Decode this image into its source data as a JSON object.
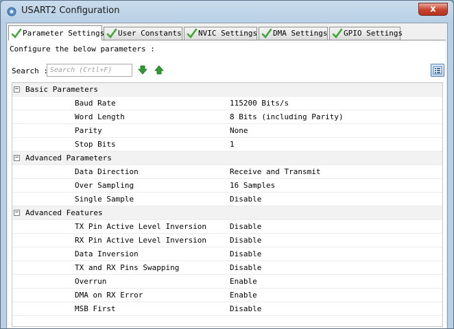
{
  "window": {
    "title": "USART2 Configuration",
    "close_label": "x"
  },
  "tabs": [
    {
      "label": "Parameter Settings",
      "active": true,
      "icon": "check-icon"
    },
    {
      "label": "User Constants",
      "active": false,
      "icon": "check-icon"
    },
    {
      "label": "NVIC Settings",
      "active": false,
      "icon": "check-icon"
    },
    {
      "label": "DMA Settings",
      "active": false,
      "icon": "check-icon"
    },
    {
      "label": "GPIO Settings",
      "active": false,
      "icon": "check-icon"
    }
  ],
  "description": "Configure the below parameters :",
  "search": {
    "label": "Search :",
    "placeholder": "Search (Crtl+F)",
    "value": ""
  },
  "groups": [
    {
      "label": "Basic Parameters",
      "expanded": true,
      "params": [
        {
          "name": "Baud Rate",
          "value": "115200 Bits/s"
        },
        {
          "name": "Word Length",
          "value": "8 Bits (including Parity)"
        },
        {
          "name": "Parity",
          "value": "None"
        },
        {
          "name": "Stop Bits",
          "value": "1"
        }
      ]
    },
    {
      "label": "Advanced Parameters",
      "expanded": true,
      "params": [
        {
          "name": "Data Direction",
          "value": "Receive and Transmit"
        },
        {
          "name": "Over Sampling",
          "value": "16 Samples"
        },
        {
          "name": "Single Sample",
          "value": "Disable"
        }
      ]
    },
    {
      "label": "Advanced Features",
      "expanded": true,
      "params": [
        {
          "name": "TX Pin Active Level Inversion",
          "value": "Disable"
        },
        {
          "name": "RX Pin Active Level Inversion",
          "value": "Disable"
        },
        {
          "name": "Data Inversion",
          "value": "Disable"
        },
        {
          "name": "TX and RX Pins Swapping",
          "value": "Disable"
        },
        {
          "name": "Overrun",
          "value": "Enable"
        },
        {
          "name": "DMA on RX Error",
          "value": "Enable"
        },
        {
          "name": "MSB First",
          "value": "Disable"
        }
      ]
    }
  ],
  "colors": {
    "check_green": "#3fa535",
    "arrow_green": "#2e9b2e",
    "close_red": "#c7432d"
  }
}
